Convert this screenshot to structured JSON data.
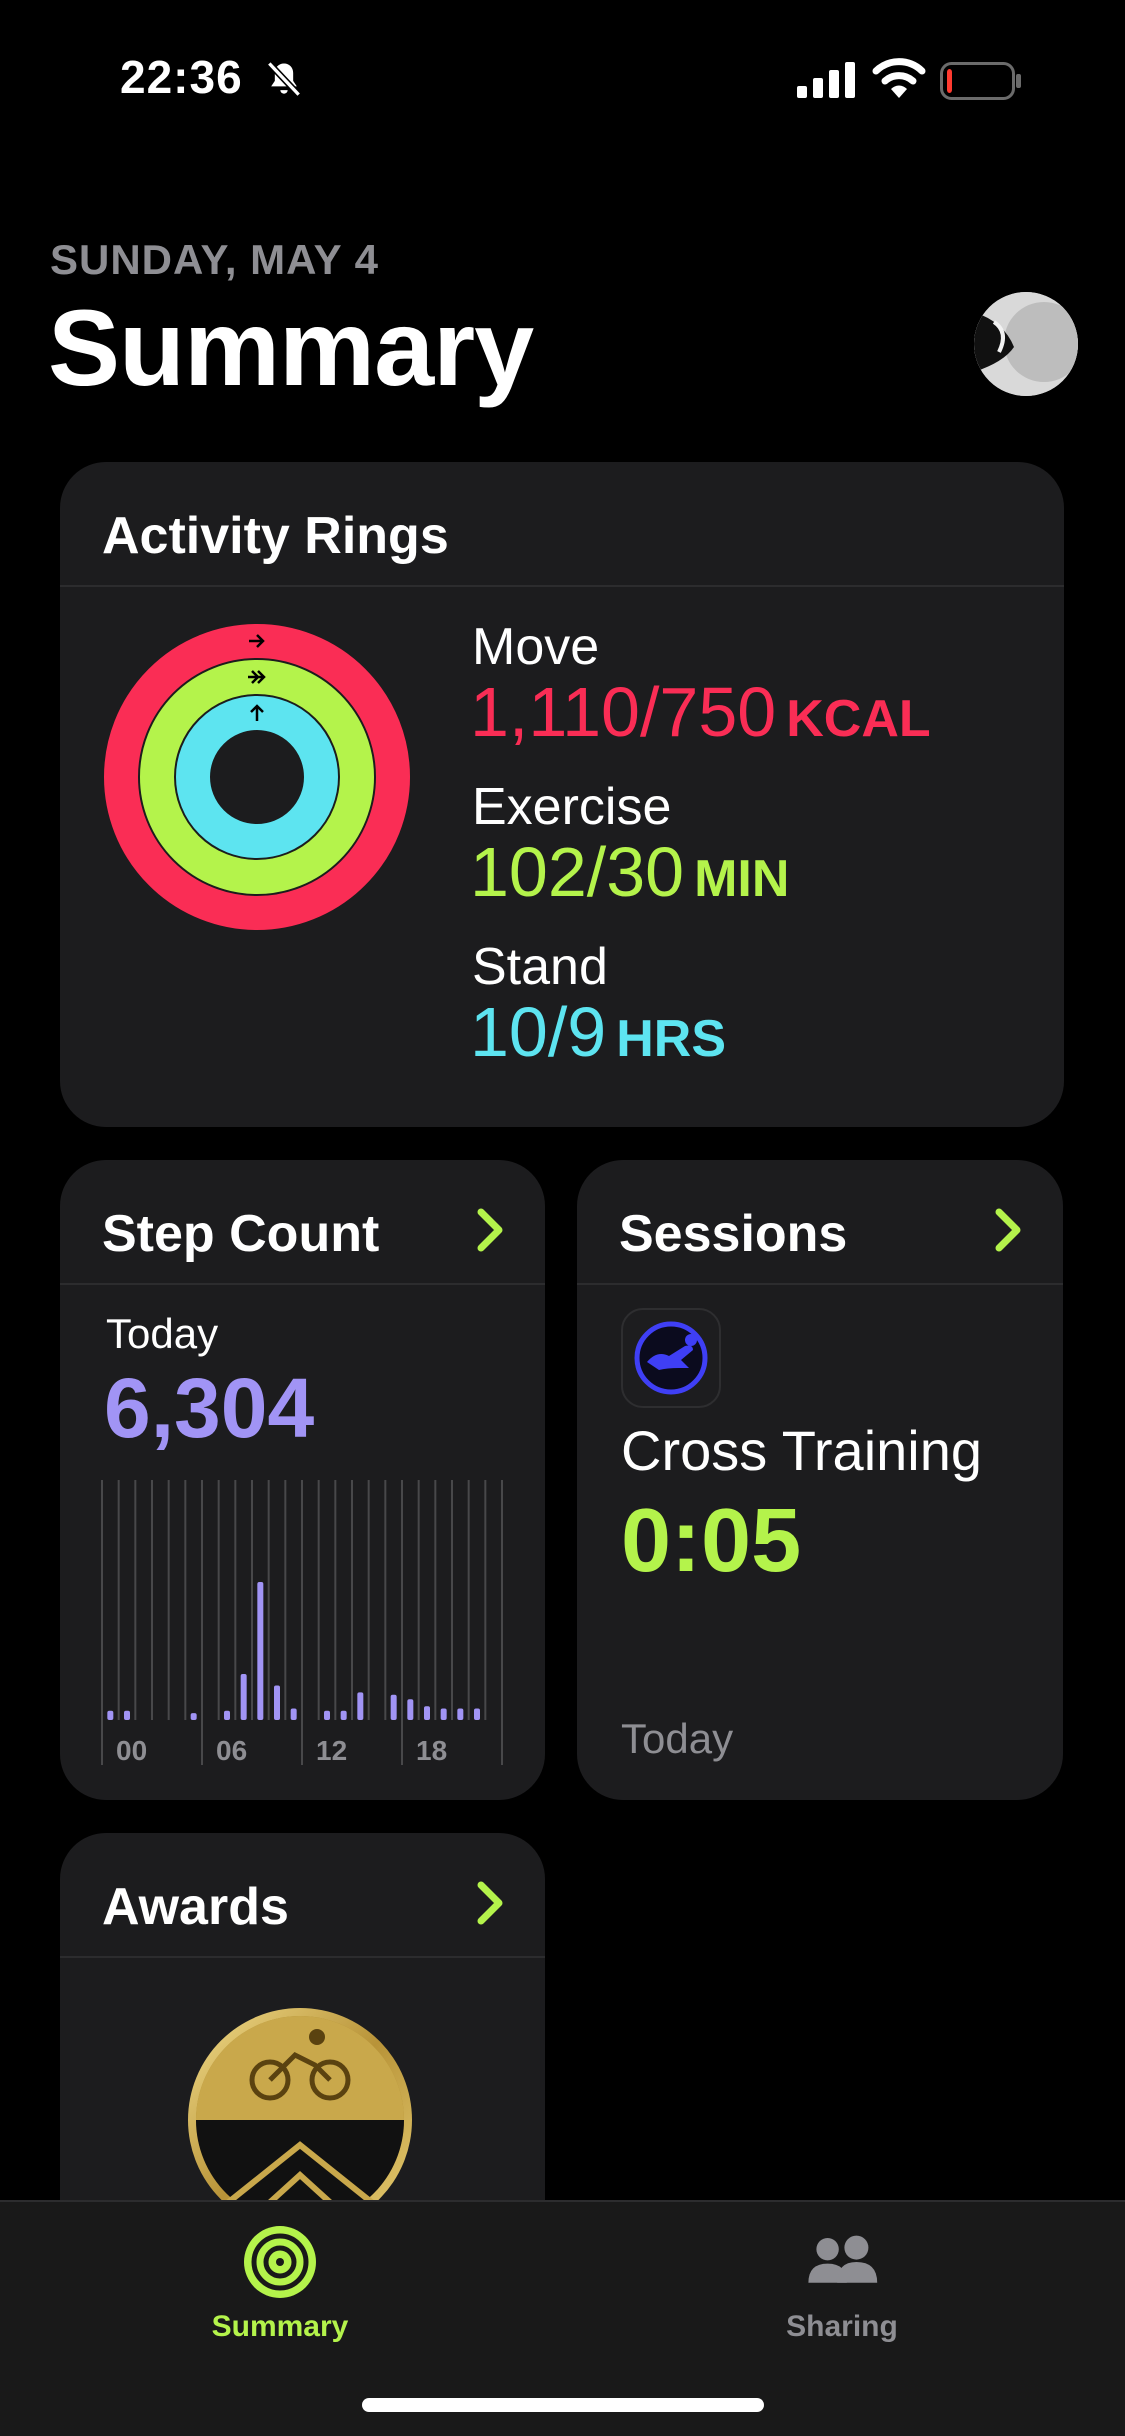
{
  "status_bar": {
    "time": "22:36",
    "icons": [
      "bell-slash-icon",
      "signal-icon",
      "wifi-icon",
      "battery-icon"
    ],
    "battery_level": 0.08,
    "battery_color": "#ff3b30"
  },
  "header": {
    "date": "SUNDAY, MAY 4",
    "title": "Summary"
  },
  "activity": {
    "title": "Activity Rings",
    "move": {
      "label": "Move",
      "value": "1,110/750",
      "unit": "KCAL",
      "color": "#fa2d55",
      "progress": 1.48
    },
    "exercise": {
      "label": "Exercise",
      "value": "102/30",
      "unit": "MIN",
      "color": "#b4f34b",
      "progress": 3.4
    },
    "stand": {
      "label": "Stand",
      "value": "10/9",
      "unit": "HRS",
      "color": "#5de4f0",
      "progress": 1.11
    }
  },
  "step_count": {
    "title": "Step Count",
    "period": "Today",
    "value": "6,304",
    "bar_color": "#a194f5",
    "x_ticks": [
      "00",
      "06",
      "12",
      "18"
    ],
    "hourly_relative": [
      0.04,
      0.04,
      0,
      0,
      0,
      0.03,
      0,
      0.04,
      0.2,
      0.6,
      0.15,
      0.05,
      0,
      0.04,
      0.04,
      0.12,
      0,
      0.11,
      0.09,
      0.06,
      0.05,
      0.05,
      0.05,
      0
    ]
  },
  "sessions": {
    "title": "Sessions",
    "icon": "cross-training-icon",
    "name": "Cross Training",
    "duration": "0:05",
    "date": "Today"
  },
  "awards": {
    "title": "Awards",
    "medal": "cycling-award-medal"
  },
  "tab_bar": {
    "tabs": [
      {
        "label": "Summary",
        "icon": "activity-rings-icon",
        "active": true
      },
      {
        "label": "Sharing",
        "icon": "people-icon",
        "active": false
      }
    ],
    "accent": "#b4f34b"
  }
}
